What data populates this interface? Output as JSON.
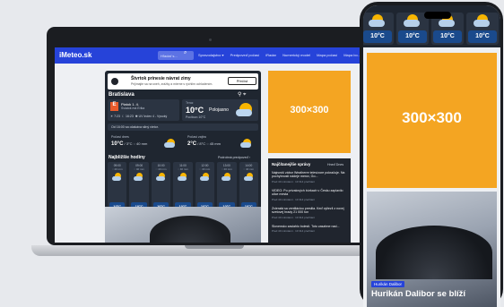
{
  "site": {
    "logo": "iMeteo.sk",
    "search_placeholder": "Hľadať s...",
    "menu": [
      "Spravodajstvo ▾",
      "Predpoveď počasí",
      "iRadar",
      "Numerický model",
      "Mapa počasí",
      "Mapa bo..."
    ]
  },
  "notification": {
    "title": "Štvrtok prinesie návrat zimy",
    "subtitle": "Prijímajte sa na sneh, zrážky a mierne s rýchlim ochladením.",
    "button": "Přečíst"
  },
  "location": {
    "city": "Bratislava"
  },
  "nameday": {
    "badge": "E",
    "date": "Piatok 1. 4.",
    "line2": "Sviatok má Erika",
    "sunrise": "☀ 7:23",
    "sunset": "☾ 16:23",
    "uv": "✺ UV Index 4 - Vysoký"
  },
  "current": {
    "label": "Teraz",
    "temp": "10°C",
    "condition": "Polojasno",
    "feels": "Pocitovo 10°C"
  },
  "alert": "Od 16:00 sa očakáva silný vietor.",
  "days": [
    {
      "label": "Počasí dnes",
      "temp": "10°C",
      "minmax": " / 3°C  ◌ 40 mm"
    },
    {
      "label": "Počasí zajtra",
      "temp": "2°C",
      "minmax": " / 8°C  ◌ 45 mm"
    }
  ],
  "hourly": {
    "title": "Najbližšie hodiny",
    "link": "Podrobná predpoveď ›",
    "items": [
      {
        "hour": "09:00",
        "rain": "◌ 40 mm",
        "temp": "10°C"
      },
      {
        "hour": "09:00",
        "rain": "◌ 40 mm",
        "temp": "10°C"
      },
      {
        "hour": "10:00",
        "rain": "◌ 40 mm",
        "temp": "10°C"
      },
      {
        "hour": "11:00",
        "rain": "◌ 40 mm",
        "temp": "10°C"
      },
      {
        "hour": "12:00",
        "rain": "◌ 40 mm",
        "temp": "10°C"
      },
      {
        "hour": "13:00",
        "rain": "◌ 40 mm",
        "temp": "10°C"
      },
      {
        "hour": "14:00",
        "rain": "◌ 40 mm",
        "temp": "10°C"
      }
    ]
  },
  "ad": {
    "label": "300×300"
  },
  "news": {
    "title": "Najčítanejšie správy",
    "tabs": "Hneď  Dnes",
    "items": [
      {
        "title": "Najnovší zábor Weatherre televízore pokračuje. Na pochybnosti nádeje merov, Go...",
        "meta": "Pred 40 minútami · 10 314 prečítaní"
      },
      {
        "title": "VIDEO: Po prívalových búrkach v Česku zaplavilo ulice mesta",
        "meta": "Pred 40 minútami · 10 314 prečítaní"
      },
      {
        "title": "Zvieratá sa ventiláciou presilia. Keď vyliezli z novej svetovej hrady 21 000 ton",
        "meta": "Pred 40 minútami · 10 314 prečítaní"
      },
      {
        "title": "Slovensko zasiahlo bolesti. Toto zasahne nad...",
        "meta": "Pred 40 minútami · 10 314 prečítaní"
      }
    ]
  },
  "phone": {
    "tiles": [
      "10°C",
      "10°C",
      "10°C",
      "10°C"
    ],
    "ad": "300×300",
    "story_tag": "Hurikán Dalibor",
    "story_title": "Hurikán Dalibor se blíží"
  },
  "colors": {
    "brand": "#2643d9",
    "ad": "#f4a522",
    "card": "#1f2630",
    "temp_badge": "#1a4a8c"
  },
  "icons": [
    "search-icon",
    "bell-icon",
    "location-icon",
    "sun-cloud-icon",
    "info-icon"
  ]
}
